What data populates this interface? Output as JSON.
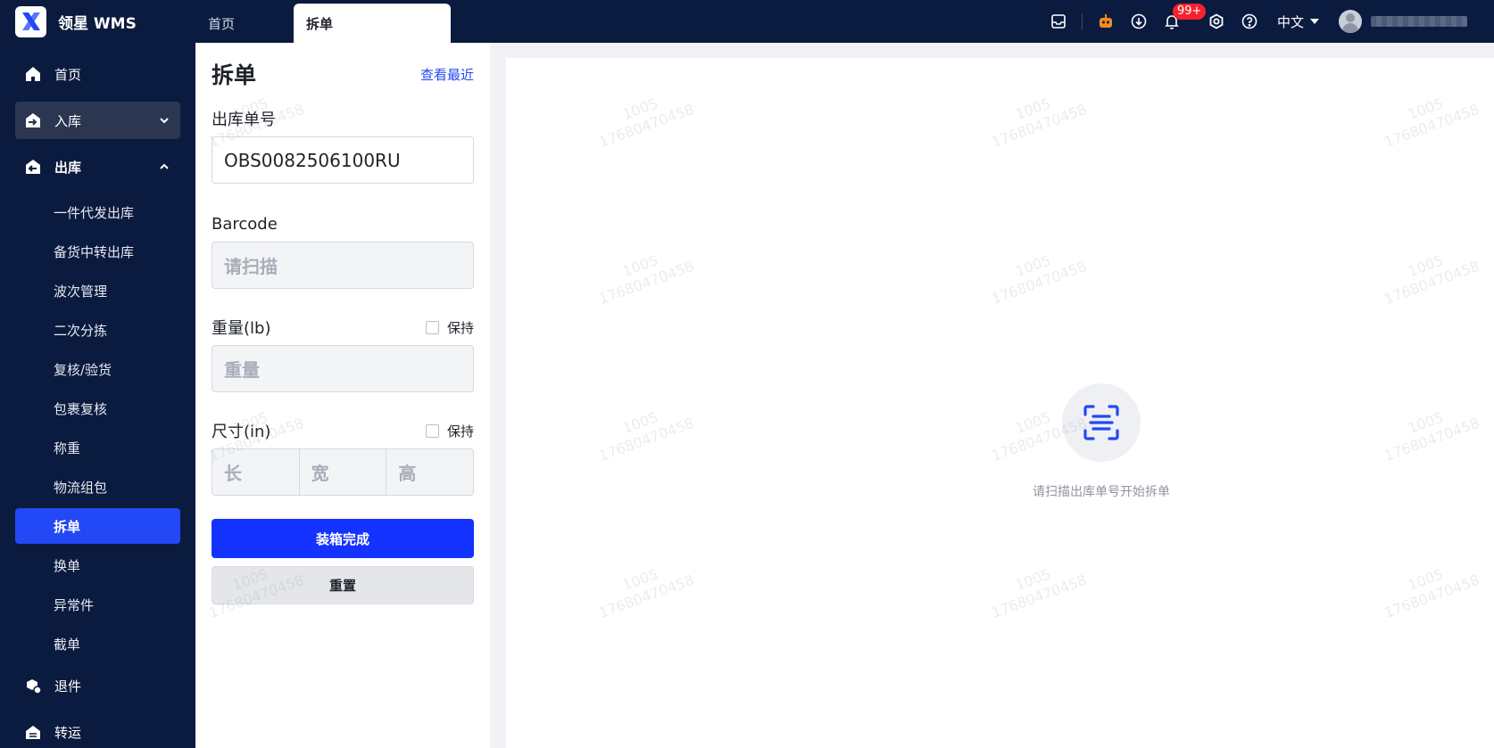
{
  "brand": {
    "name": "领星 WMS"
  },
  "tabs": [
    {
      "label": "首页"
    },
    {
      "label": "拆单"
    }
  ],
  "header": {
    "badge_count": "99+",
    "language": "中文"
  },
  "sidebar": {
    "items": [
      {
        "label": "首页",
        "icon": "home-icon"
      },
      {
        "label": "入库",
        "icon": "inbound-icon"
      },
      {
        "label": "出库",
        "icon": "outbound-icon"
      }
    ],
    "outbound_sub": [
      {
        "label": "一件代发出库"
      },
      {
        "label": "备货中转出库"
      },
      {
        "label": "波次管理"
      },
      {
        "label": "二次分拣"
      },
      {
        "label": "复核/验货"
      },
      {
        "label": "包裹复核"
      },
      {
        "label": "称重"
      },
      {
        "label": "物流组包"
      },
      {
        "label": "拆单"
      },
      {
        "label": "换单"
      },
      {
        "label": "异常件"
      },
      {
        "label": "截单"
      }
    ],
    "bottom_items": [
      {
        "label": "退件",
        "icon": "return-icon"
      },
      {
        "label": "转运",
        "icon": "transfer-icon"
      }
    ]
  },
  "form": {
    "title": "拆单",
    "recent_link": "查看最近",
    "order_label": "出库单号",
    "order_value": "OBS0082506100RU",
    "barcode_label": "Barcode",
    "barcode_placeholder": "请扫描",
    "weight_label": "重量(lb)",
    "weight_placeholder": "重量",
    "keep_label": "保持",
    "size_label": "尺寸(in)",
    "length_placeholder": "长",
    "width_placeholder": "宽",
    "height_placeholder": "高",
    "submit_label": "装箱完成",
    "reset_label": "重置"
  },
  "empty_state": {
    "message": "请扫描出库单号开始拆单"
  },
  "watermark": {
    "line1": "1005",
    "line2": "17680470458"
  },
  "colors": {
    "primary": "#1433ff",
    "sidebar_bg": "#0b1b3f",
    "active_nav": "#2348f5"
  }
}
